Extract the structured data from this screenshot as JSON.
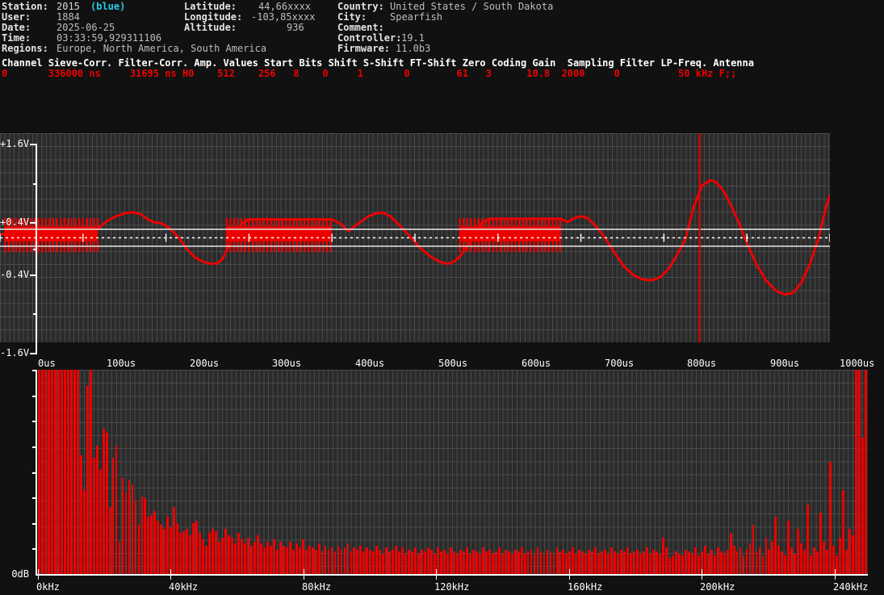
{
  "header": {
    "rows_left": [
      {
        "label": "Station:",
        "value": "2015",
        "extra": "(blue)"
      },
      {
        "label": "User:",
        "value": "1884"
      },
      {
        "label": "Date:",
        "value": "2025-06-25"
      },
      {
        "label": "Time:",
        "value": "03:33:59,929311106"
      },
      {
        "label": "Regions:",
        "value": "Europe, North America, South America"
      }
    ],
    "rows_mid": [
      {
        "label": "Latitude:",
        "value": "44,66xxxx"
      },
      {
        "label": "Longitude:",
        "value": "-103,85xxxx"
      },
      {
        "label": "Altitude:",
        "value": "936"
      }
    ],
    "rows_right": [
      {
        "label": "Country:",
        "value": "United States / South Dakota"
      },
      {
        "label": "City:",
        "value": "Spearfish"
      },
      {
        "label": "Comment:",
        "value": ""
      },
      {
        "label": "Controller:",
        "value": "19.1"
      },
      {
        "label": "Firmware:",
        "value": "11.0b3"
      }
    ]
  },
  "channel_table": {
    "header_line": "Channel Sieve-Corr. Filter-Corr. Amp. Values Start Bits Shift S-Shift FT-Shift Zero Coding Gain  Sampling Filter LP-Freq. Antenna",
    "value_line": "0       336000 ns     31695 ns H0    512    256   8    0     1       0        61   3      10.8  2000     0          50 kHz F;;",
    "columns": [
      "Channel",
      "Sieve-Corr.",
      "Filter-Corr.",
      "Amp.",
      "Values",
      "Start",
      "Bits",
      "Shift",
      "S-Shift",
      "FT-Shift",
      "Zero",
      "Coding",
      "Gain",
      "Sampling",
      "Filter",
      "LP-Freq.",
      "Antenna"
    ],
    "values": [
      "0",
      "336000 ns",
      "31695 ns",
      "H0",
      "512",
      "256",
      "8",
      "0",
      "1",
      "0",
      "61",
      "3",
      "10.8",
      "2000",
      "0",
      "50 kHz",
      "F;;"
    ]
  },
  "colors": {
    "trace": "#ee0000",
    "grid": "#4a4a4a",
    "plot_bg": "#2b2b2b",
    "page_bg": "#111111",
    "axis": "#ffffff",
    "blue_tag": "#24d0e8"
  },
  "chart_data": [
    {
      "type": "line",
      "name": "waveform",
      "title": "",
      "xlabel": "",
      "ylabel": "",
      "xlim": [
        0,
        1000
      ],
      "ylim": [
        -1.6,
        1.6
      ],
      "xunit": "us",
      "yunit": "V",
      "xticks": [
        0,
        100,
        200,
        300,
        400,
        500,
        600,
        700,
        800,
        900,
        1000
      ],
      "xticklabels": [
        "0us",
        "100us",
        "200us",
        "300us",
        "400us",
        "500us",
        "600us",
        "700us",
        "800us",
        "900us",
        "1000us"
      ],
      "yticks": [
        1.6,
        0.4,
        -0.4,
        -1.6
      ],
      "yticklabels": [
        "+1.6V",
        "+0.4V",
        "-0.4V",
        "-1.6V"
      ],
      "grid": true,
      "threshold_levels": [
        0.13,
        -0.13
      ],
      "zero_level": 0.0,
      "trigger_time_us": 843,
      "burst_windows_us": [
        [
          5,
          118
        ],
        [
          272,
          400
        ],
        [
          553,
          676
        ]
      ],
      "burst_amp_top": 0.3,
      "burst_amp_bottom": -0.22,
      "envelope_points": [
        [
          0,
          0.05
        ],
        [
          10,
          0.06
        ],
        [
          30,
          0.07
        ],
        [
          60,
          0.08
        ],
        [
          90,
          0.09
        ],
        [
          110,
          0.1
        ],
        [
          118,
          0.14
        ],
        [
          128,
          0.25
        ],
        [
          140,
          0.33
        ],
        [
          152,
          0.38
        ],
        [
          160,
          0.39
        ],
        [
          170,
          0.36
        ],
        [
          178,
          0.28
        ],
        [
          185,
          0.24
        ],
        [
          195,
          0.22
        ],
        [
          205,
          0.14
        ],
        [
          215,
          0.01
        ],
        [
          225,
          -0.17
        ],
        [
          235,
          -0.3
        ],
        [
          245,
          -0.37
        ],
        [
          255,
          -0.4
        ],
        [
          262,
          -0.39
        ],
        [
          268,
          -0.33
        ],
        [
          272,
          -0.22
        ],
        [
          278,
          -0.06
        ],
        [
          285,
          0.1
        ],
        [
          292,
          0.22
        ],
        [
          300,
          0.28
        ],
        [
          400,
          0.28
        ],
        [
          410,
          0.22
        ],
        [
          420,
          0.1
        ],
        [
          432,
          0.22
        ],
        [
          444,
          0.33
        ],
        [
          455,
          0.38
        ],
        [
          462,
          0.38
        ],
        [
          470,
          0.33
        ],
        [
          480,
          0.21
        ],
        [
          492,
          0.05
        ],
        [
          505,
          -0.14
        ],
        [
          518,
          -0.28
        ],
        [
          530,
          -0.37
        ],
        [
          540,
          -0.4
        ],
        [
          548,
          -0.36
        ],
        [
          556,
          -0.26
        ],
        [
          564,
          -0.1
        ],
        [
          572,
          0.09
        ],
        [
          580,
          0.22
        ],
        [
          590,
          0.29
        ],
        [
          676,
          0.29
        ],
        [
          684,
          0.24
        ],
        [
          692,
          0.3
        ],
        [
          700,
          0.33
        ],
        [
          708,
          0.3
        ],
        [
          718,
          0.18
        ],
        [
          728,
          0.02
        ],
        [
          740,
          -0.22
        ],
        [
          752,
          -0.44
        ],
        [
          764,
          -0.58
        ],
        [
          775,
          -0.64
        ],
        [
          786,
          -0.65
        ],
        [
          796,
          -0.6
        ],
        [
          806,
          -0.47
        ],
        [
          816,
          -0.26
        ],
        [
          826,
          -0.02
        ],
        [
          836,
          0.48
        ],
        [
          846,
          0.8
        ],
        [
          856,
          0.88
        ],
        [
          862,
          0.86
        ],
        [
          870,
          0.75
        ],
        [
          880,
          0.52
        ],
        [
          890,
          0.24
        ],
        [
          900,
          -0.08
        ],
        [
          912,
          -0.42
        ],
        [
          924,
          -0.67
        ],
        [
          936,
          -0.82
        ],
        [
          946,
          -0.87
        ],
        [
          956,
          -0.84
        ],
        [
          966,
          -0.68
        ],
        [
          976,
          -0.4
        ],
        [
          986,
          -0.02
        ],
        [
          996,
          0.5
        ],
        [
          1006,
          0.84
        ],
        [
          1016,
          1.0
        ],
        [
          1026,
          1.04
        ],
        [
          1036,
          1.01
        ],
        [
          1044,
          0.95
        ]
      ]
    },
    {
      "type": "bar",
      "name": "spectrum",
      "title": "",
      "xlabel": "",
      "ylabel": "",
      "xlim": [
        0,
        250
      ],
      "ylim": [
        0,
        100
      ],
      "xunit": "kHz",
      "yunit": "dB",
      "xticks": [
        0,
        40,
        80,
        120,
        160,
        200,
        240
      ],
      "xticklabels": [
        "0kHz",
        "40kHz",
        "80kHz",
        "120kHz",
        "160kHz",
        "200kHz",
        "240kHz"
      ],
      "yticklabels": [
        "0dB"
      ],
      "grid": true,
      "bin_count": 256,
      "values": [
        100,
        100,
        100,
        100,
        100,
        100,
        100,
        100,
        100,
        100,
        100,
        100,
        100,
        58,
        41,
        92,
        100,
        57,
        63,
        51,
        71,
        69,
        33,
        57,
        63,
        16,
        47,
        40,
        46,
        44,
        36,
        24,
        38,
        37,
        28,
        29,
        31,
        26,
        24,
        22,
        28,
        23,
        33,
        25,
        20,
        21,
        22,
        19,
        25,
        26,
        20,
        17,
        14,
        20,
        22,
        21,
        16,
        18,
        22,
        19,
        18,
        15,
        20,
        17,
        15,
        18,
        14,
        16,
        19,
        15,
        13,
        16,
        14,
        17,
        12,
        16,
        14,
        13,
        16,
        12,
        15,
        13,
        17,
        12,
        14,
        13,
        12,
        15,
        11,
        14,
        12,
        13,
        11,
        14,
        12,
        13,
        15,
        11,
        13,
        12,
        14,
        11,
        13,
        12,
        11,
        14,
        12,
        10,
        13,
        11,
        12,
        14,
        11,
        13,
        10,
        12,
        11,
        13,
        10,
        12,
        11,
        13,
        12,
        10,
        13,
        11,
        12,
        10,
        13,
        11,
        10,
        12,
        11,
        13,
        10,
        12,
        11,
        10,
        13,
        11,
        12,
        10,
        11,
        13,
        10,
        12,
        11,
        10,
        12,
        11,
        13,
        10,
        11,
        12,
        10,
        13,
        11,
        10,
        12,
        11,
        10,
        13,
        11,
        12,
        10,
        11,
        13,
        10,
        12,
        11,
        10,
        12,
        11,
        13,
        10,
        11,
        12,
        10,
        13,
        11,
        10,
        12,
        11,
        13,
        10,
        11,
        12,
        10,
        11,
        13,
        10,
        12,
        11,
        10,
        18,
        13,
        8,
        9,
        11,
        10,
        9,
        12,
        11,
        10,
        13,
        9,
        11,
        14,
        10,
        12,
        9,
        13,
        11,
        10,
        12,
        20,
        14,
        11,
        13,
        9,
        12,
        15,
        24,
        11,
        13,
        9,
        18,
        12,
        16,
        28,
        14,
        11,
        9,
        26,
        13,
        10,
        22,
        15,
        12,
        34,
        9,
        13,
        11,
        30,
        16,
        12,
        55,
        14,
        9,
        18,
        41,
        12,
        22,
        19,
        100,
        100,
        67,
        100
      ]
    }
  ]
}
